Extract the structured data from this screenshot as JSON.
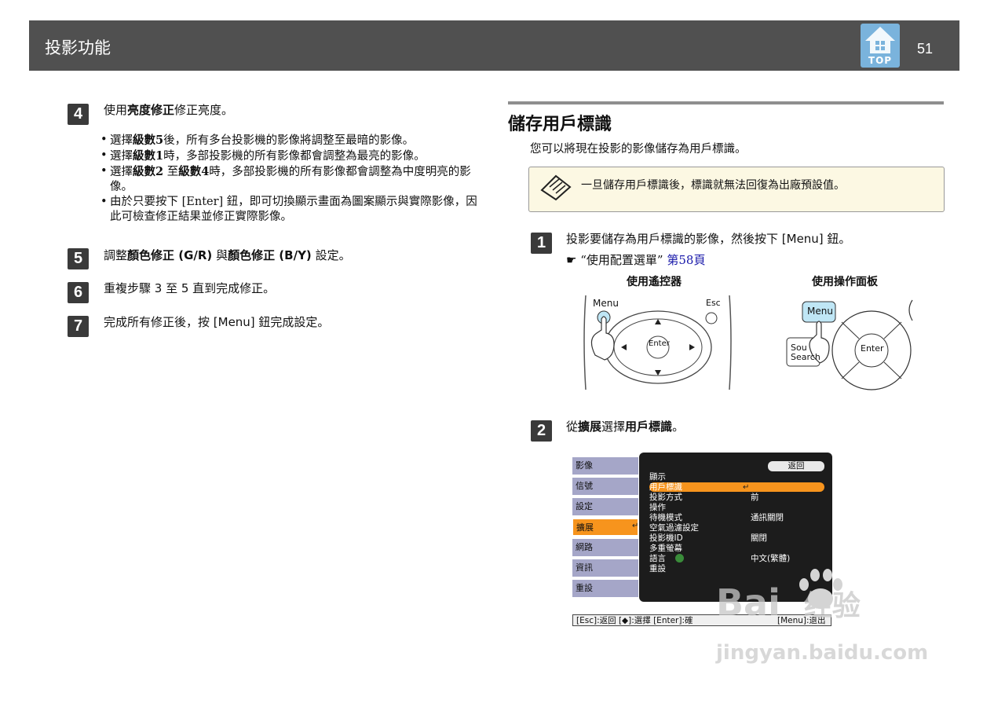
{
  "header": {
    "title": "投影功能",
    "page_number": "51",
    "top_label": "TOP"
  },
  "left": {
    "step4": {
      "num": "4",
      "pre": "使用",
      "bold": "亮度修正",
      "post": "修正亮度。"
    },
    "bullets": [
      {
        "a": "選擇",
        "b": "級數5",
        "c": "後，所有多台投影機的影像將調整至最暗的影像。"
      },
      {
        "a": "選擇",
        "b": "級數1",
        "c": "時，多部投影機的所有影像都會調整為最亮的影像。"
      },
      {
        "a": "選擇",
        "b": "級數2",
        "c": " 至",
        "d": "級數4",
        "e": "時，多部投影機的所有影像都會調整為中度明亮的影像。"
      },
      {
        "a": "由於只要按下 [Enter] 鈕，即可切換顯示畫面為圖案顯示與實際影像，因此可檢查修正結果並修正實際影像。"
      }
    ],
    "step5": {
      "num": "5",
      "a": "調整",
      "b": "顏色修正 (G/R)",
      "c": " 與",
      "d": "顏色修正 (B/Y)",
      "e": " 設定。"
    },
    "step6": {
      "num": "6",
      "text": "重複步驟 3 至 5 直到完成修正。"
    },
    "step7": {
      "num": "7",
      "text": "完成所有修正後，按 [Menu] 鈕完成設定。"
    }
  },
  "right": {
    "section_title": "儲存用戶標識",
    "intro": "您可以將現在投影的影像儲存為用戶標識。",
    "note": "一旦儲存用戶標識後，標識就無法回復為出廠預設值。",
    "step1": {
      "num": "1",
      "text": "投影要儲存為用戶標識的影像，然後按下 [Menu] 鈕。",
      "ref_glyph": "☛",
      "ref_text": "“使用配置選單”",
      "ref_link": "第58頁"
    },
    "remote": {
      "caption": "使用遙控器",
      "menu": "Menu",
      "esc": "Esc",
      "enter": "Enter"
    },
    "panel": {
      "caption": "使用操作面板",
      "menu": "Menu",
      "source": "Sou",
      "search": "Search",
      "enter": "Enter"
    },
    "step2": {
      "num": "2",
      "a": "從",
      "b": "擴展",
      "c": "選擇",
      "d": "用戶標識",
      "e": "。"
    },
    "menu_screen": {
      "left_items": [
        "影像",
        "信號",
        "設定",
        "擴展",
        "網路",
        "資訊",
        "重設"
      ],
      "back": "返回",
      "rows": [
        {
          "label": "顯示",
          "value": ""
        },
        {
          "label": "用戶標識",
          "value": ""
        },
        {
          "label": "投影方式",
          "value": "前"
        },
        {
          "label": "操作",
          "value": ""
        },
        {
          "label": "待機模式",
          "value": "通訊關閉"
        },
        {
          "label": "空氣過濾設定",
          "value": ""
        },
        {
          "label": "投影機ID",
          "value": "關閉"
        },
        {
          "label": "多重螢幕",
          "value": ""
        },
        {
          "label": "語言",
          "value": "中文(繁體)"
        },
        {
          "label": "重設",
          "value": ""
        }
      ],
      "status_left": "[Esc]:返回 [◆]:選擇 [Enter]:確",
      "status_right": "[Menu]:退出"
    }
  },
  "watermark": {
    "brand": "Bai",
    "brand2": "经验",
    "url": "jingyan.baidu.com"
  },
  "colors": {
    "header_bg": "#505050",
    "accent_orange": "#f7941d",
    "menu_left_bg": "#a5a6c8",
    "note_bg": "#fcf8e3"
  }
}
